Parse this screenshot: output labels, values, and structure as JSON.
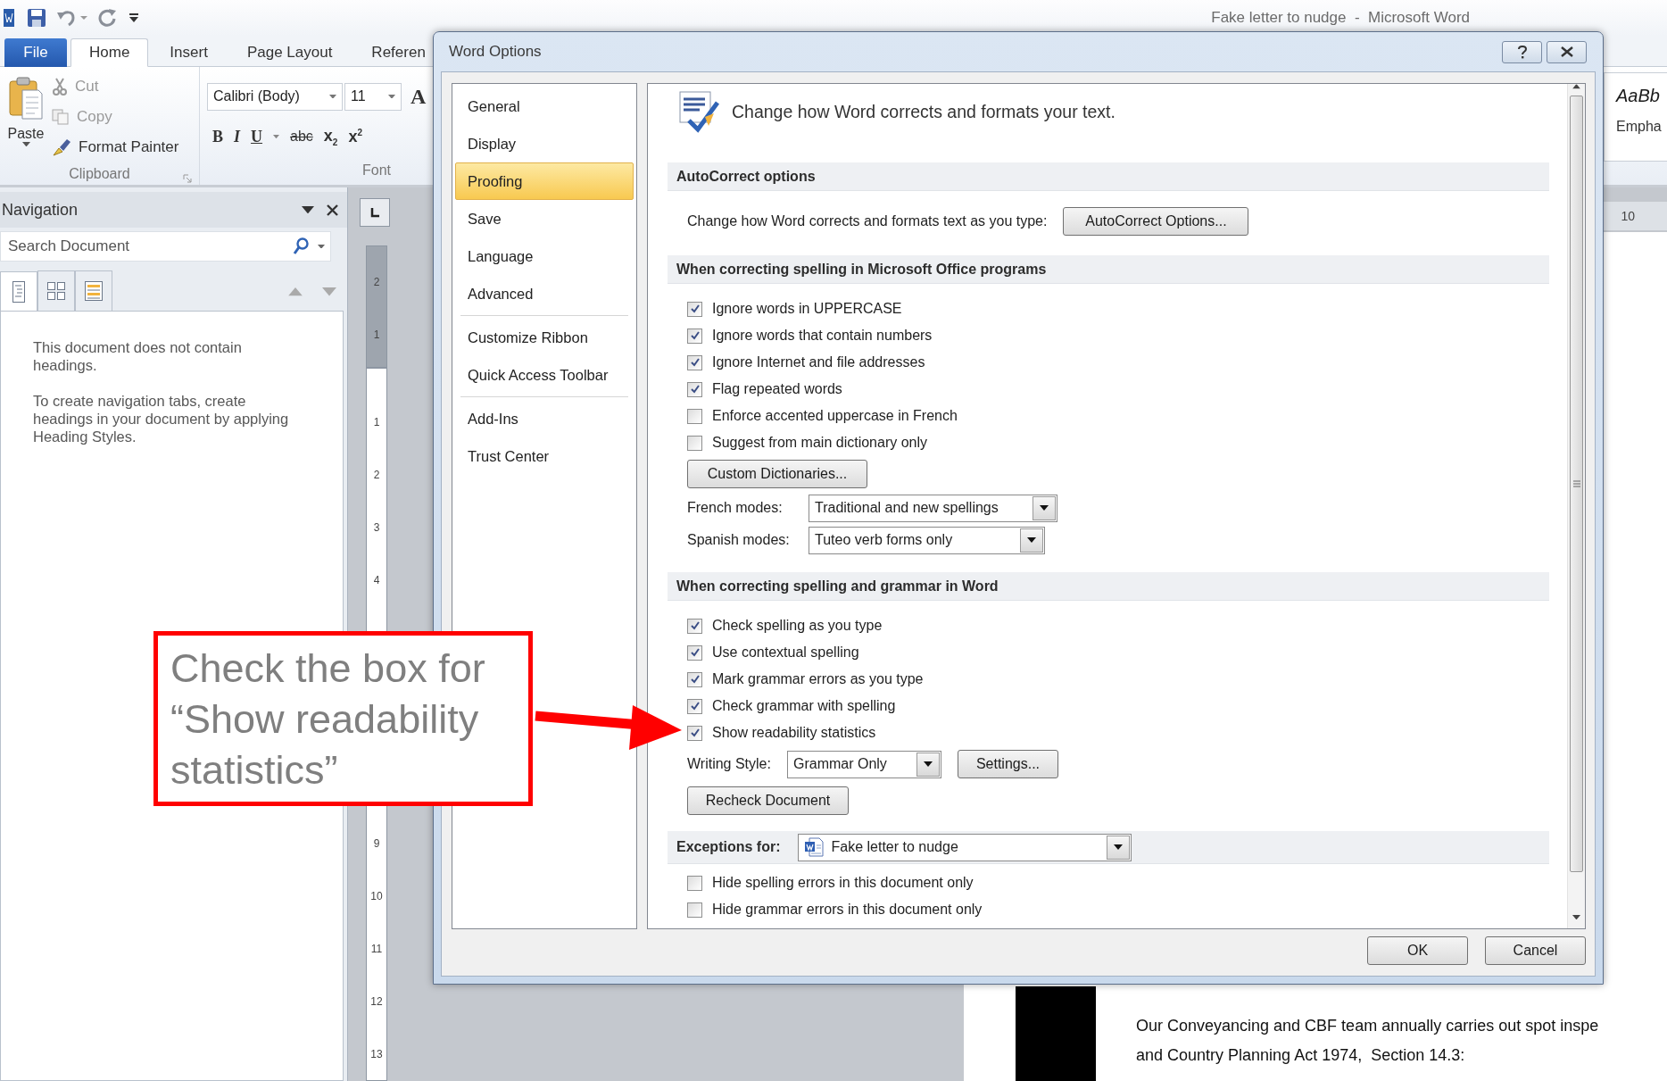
{
  "title_bar": {
    "title": "Fake letter to nudge  -  Microsoft Word"
  },
  "ribbon_tabs": [
    {
      "label": "File",
      "kind": "file",
      "selected": false
    },
    {
      "label": "Home",
      "kind": "tab",
      "selected": true
    },
    {
      "label": "Insert",
      "kind": "tab",
      "selected": false
    },
    {
      "label": "Page Layout",
      "kind": "tab",
      "selected": false
    },
    {
      "label": "Referen",
      "kind": "tab",
      "selected": false
    }
  ],
  "clipboard": {
    "paste": "Paste",
    "items": [
      {
        "kind": "cut",
        "label": "Cut",
        "disabled": true
      },
      {
        "kind": "copy",
        "label": "Copy",
        "disabled": true
      },
      {
        "kind": "painter",
        "label": "Format Painter",
        "disabled": false
      }
    ],
    "group_label": "Clipboard"
  },
  "font": {
    "font_name": "Calibri (Body)",
    "font_size": "11",
    "grow": "A",
    "format_buttons": [
      {
        "kind": "bold",
        "label": "B"
      },
      {
        "kind": "italic",
        "label": "I"
      },
      {
        "kind": "underline",
        "label": "U"
      },
      {
        "kind": "strike",
        "label": "abc"
      },
      {
        "kind": "subscript",
        "label": "x$_{2}$"
      },
      {
        "kind": "superscript",
        "label": "x$^{2}$"
      }
    ],
    "group_label": "Font"
  },
  "styles": [
    {
      "sample": "AaBb",
      "name": "Empha"
    }
  ],
  "navigation": {
    "title": "Navigation",
    "search_placeholder": "Search Document",
    "view_tabs": [
      {
        "kind": "headings",
        "selected": true
      },
      {
        "kind": "pages",
        "selected": false
      },
      {
        "kind": "results",
        "selected": false
      }
    ],
    "messages": [
      "This document does not contain headings.",
      "To create navigation tabs, create headings in your document by applying Heading Styles."
    ]
  },
  "ruler": {
    "top_label": "10",
    "upper": [
      "2",
      "1"
    ],
    "lower_a": [
      "1",
      "2",
      "3",
      "4"
    ],
    "lower_b": [
      "9",
      "10",
      "11",
      "12",
      "13"
    ]
  },
  "document": {
    "lines": [
      "Our Conveyancing and CBF team annually carries out spot inspe",
      "and Country Planning Act 1974,  Section 14.3:"
    ]
  },
  "dialog": {
    "title": "Word Options",
    "categories": [
      {
        "label": "General",
        "selected": false,
        "separator_after": false
      },
      {
        "label": "Display",
        "selected": false,
        "separator_after": false
      },
      {
        "label": "Proofing",
        "selected": true,
        "separator_after": false
      },
      {
        "label": "Save",
        "selected": false,
        "separator_after": false
      },
      {
        "label": "Language",
        "selected": false,
        "separator_after": false
      },
      {
        "label": "Advanced",
        "selected": false,
        "separator_after": true
      },
      {
        "label": "Customize Ribbon",
        "selected": false,
        "separator_after": false
      },
      {
        "label": "Quick Access Toolbar",
        "selected": false,
        "separator_after": true
      },
      {
        "label": "Add-Ins",
        "selected": false,
        "separator_after": false
      },
      {
        "label": "Trust Center",
        "selected": false,
        "separator_after": false
      }
    ],
    "intro": "Change how Word corrects and formats your text.",
    "sections": [
      {
        "kind": "autocorrect",
        "title": "AutoCorrect options",
        "label": "Change how Word corrects and formats text as you type:",
        "button": "AutoCorrect Options..."
      },
      {
        "kind": "office",
        "title": "When correcting spelling in Microsoft Office programs",
        "checks": [
          {
            "label": "Ignore words in UPPERCASE",
            "checked": true
          },
          {
            "label": "Ignore words that contain numbers",
            "checked": true
          },
          {
            "label": "Ignore Internet and file addresses",
            "checked": true
          },
          {
            "label": "Flag repeated words",
            "checked": true
          },
          {
            "label": "Enforce accented uppercase in French",
            "checked": false
          },
          {
            "label": "Suggest from main dictionary only",
            "checked": false
          }
        ],
        "button": "Custom Dictionaries...",
        "modes": [
          {
            "label": "French modes:",
            "value": "Traditional and new spellings"
          },
          {
            "label": "Spanish modes:",
            "value": "Tuteo verb forms only"
          }
        ]
      },
      {
        "kind": "word",
        "title": "When correcting spelling and grammar in Word",
        "checks": [
          {
            "label": "Check spelling as you type",
            "checked": true
          },
          {
            "label": "Use contextual spelling",
            "checked": true
          },
          {
            "label": "Mark grammar errors as you type",
            "checked": true
          },
          {
            "label": "Check grammar with spelling",
            "checked": true
          },
          {
            "label": "Show readability statistics",
            "checked": true
          }
        ],
        "writing_style": {
          "label": "Writing Style:",
          "value": "Grammar Only"
        },
        "settings_button": "Settings...",
        "recheck_button": "Recheck Document"
      },
      {
        "kind": "exceptions",
        "title": "Exceptions for:",
        "document": "Fake letter to nudge",
        "checks": [
          {
            "label": "Hide spelling errors in this document only",
            "checked": false
          },
          {
            "label": "Hide grammar errors in this document only",
            "checked": false
          }
        ]
      }
    ],
    "buttons": [
      "OK",
      "Cancel"
    ]
  },
  "callout": {
    "text": "Check the box for “Show readability statistics”"
  }
}
